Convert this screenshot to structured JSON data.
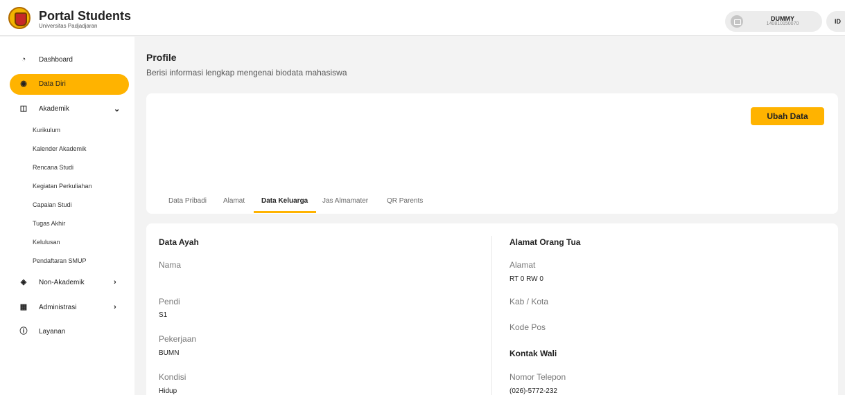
{
  "header": {
    "app_title": "Portal Students",
    "app_subtitle": "Universitas Padjadjaran",
    "user_name": "DUMMY",
    "user_id": "140810150070",
    "language": "ID"
  },
  "sidebar": {
    "items": [
      {
        "label": "Dashboard",
        "icon": "dashboard-icon"
      },
      {
        "label": "Data Diri",
        "icon": "user-circle-icon"
      },
      {
        "label": "Akademik",
        "icon": "book-icon"
      },
      {
        "label": "Non-Akademik",
        "icon": "graduation-cap-icon"
      },
      {
        "label": "Administrasi",
        "icon": "grid-icon"
      },
      {
        "label": "Layanan",
        "icon": "info-icon"
      }
    ],
    "akademik_sub": [
      "Kurikulum",
      "Kalender Akademik",
      "Rencana Studi",
      "Kegiatan Perkuliahan",
      "Capaian Studi",
      "Tugas Akhir",
      "Kelulusan",
      "Pendaftaran SMUP"
    ]
  },
  "main": {
    "title": "Profile",
    "subtitle": "Berisi informasi lengkap mengenai biodata mahasiswa",
    "edit_button": "Ubah Data",
    "tabs": [
      "Data Pribadi",
      "Alamat",
      "Data Keluarga",
      "Jas Almamater",
      "QR Parents"
    ],
    "active_tab": "Data Keluarga"
  },
  "detail": {
    "left_heading": "Data Ayah",
    "nama_label": "Nama",
    "pendi_label": "Pendi",
    "pendi_value": "S1",
    "pekerjaan_label": "Pekerjaan",
    "pekerjaan_value": "BUMN",
    "kondisi_label": "Kondisi",
    "kondisi_value": "Hidup",
    "right_heading": "Alamat Orang Tua",
    "alamat_label": "Alamat",
    "alamat_value": "RT 0 RW 0",
    "kota_label": "Kab / Kota",
    "kodepos_label": "Kode Pos",
    "kontak_heading": "Kontak Wali",
    "telepon_label": "Nomor Telepon",
    "telepon_value": "(026)-5772-232"
  },
  "colors": {
    "accent": "#ffb300"
  }
}
